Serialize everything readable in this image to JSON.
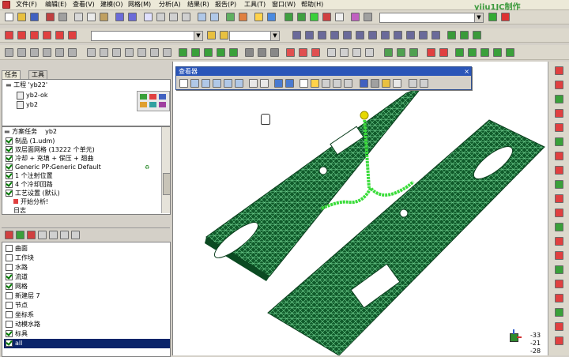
{
  "menu": [
    "文件(F)",
    "编辑(E)",
    "查看(V)",
    "建模(O)",
    "网格(M)",
    "分析(A)",
    "结果(R)",
    "报告(P)",
    "工具(T)",
    "窗口(W)",
    "帮助(H)"
  ],
  "watermark": "yiiu1JC制作",
  "project_panel": {
    "tabs": [
      "任务",
      "工具"
    ],
    "root": "工程 'yb22'",
    "items": [
      "yb2-ok",
      "yb2"
    ]
  },
  "study_panel": {
    "header": "方案任务",
    "header_file": "yb2",
    "tasks": [
      "制品 (1.udm)",
      "双层面网格 (13222 个单元)",
      "冷却 + 充填 + 保压 + 翘曲",
      "Generic PP:Generic Default",
      "1 个注射位置",
      "4 个冷却回路",
      "工艺设置 (默认)",
      "开始分析!",
      "日志"
    ]
  },
  "layers": {
    "items": [
      {
        "label": "曲面",
        "checked": false
      },
      {
        "label": "工作块",
        "checked": false
      },
      {
        "label": "水路",
        "checked": false
      },
      {
        "label": "流道",
        "checked": true
      },
      {
        "label": "网格",
        "checked": true
      },
      {
        "label": "新建层 7",
        "checked": false
      },
      {
        "label": "节点",
        "checked": false
      },
      {
        "label": "坐标系",
        "checked": false
      },
      {
        "label": "动模水路",
        "checked": false
      },
      {
        "label": "标具",
        "checked": true
      },
      {
        "label": "all",
        "checked": true,
        "selected": true
      }
    ]
  },
  "viewer_toolbar": {
    "title": "查看器"
  },
  "axes_values": [
    "-33",
    "-21",
    "-28"
  ],
  "colors": {
    "mesh": "#0f5a2a",
    "mesh_line": "#6fd08f",
    "runner": "#3bdc3b",
    "gate": "#e6d800",
    "selection": "#0a246a"
  }
}
